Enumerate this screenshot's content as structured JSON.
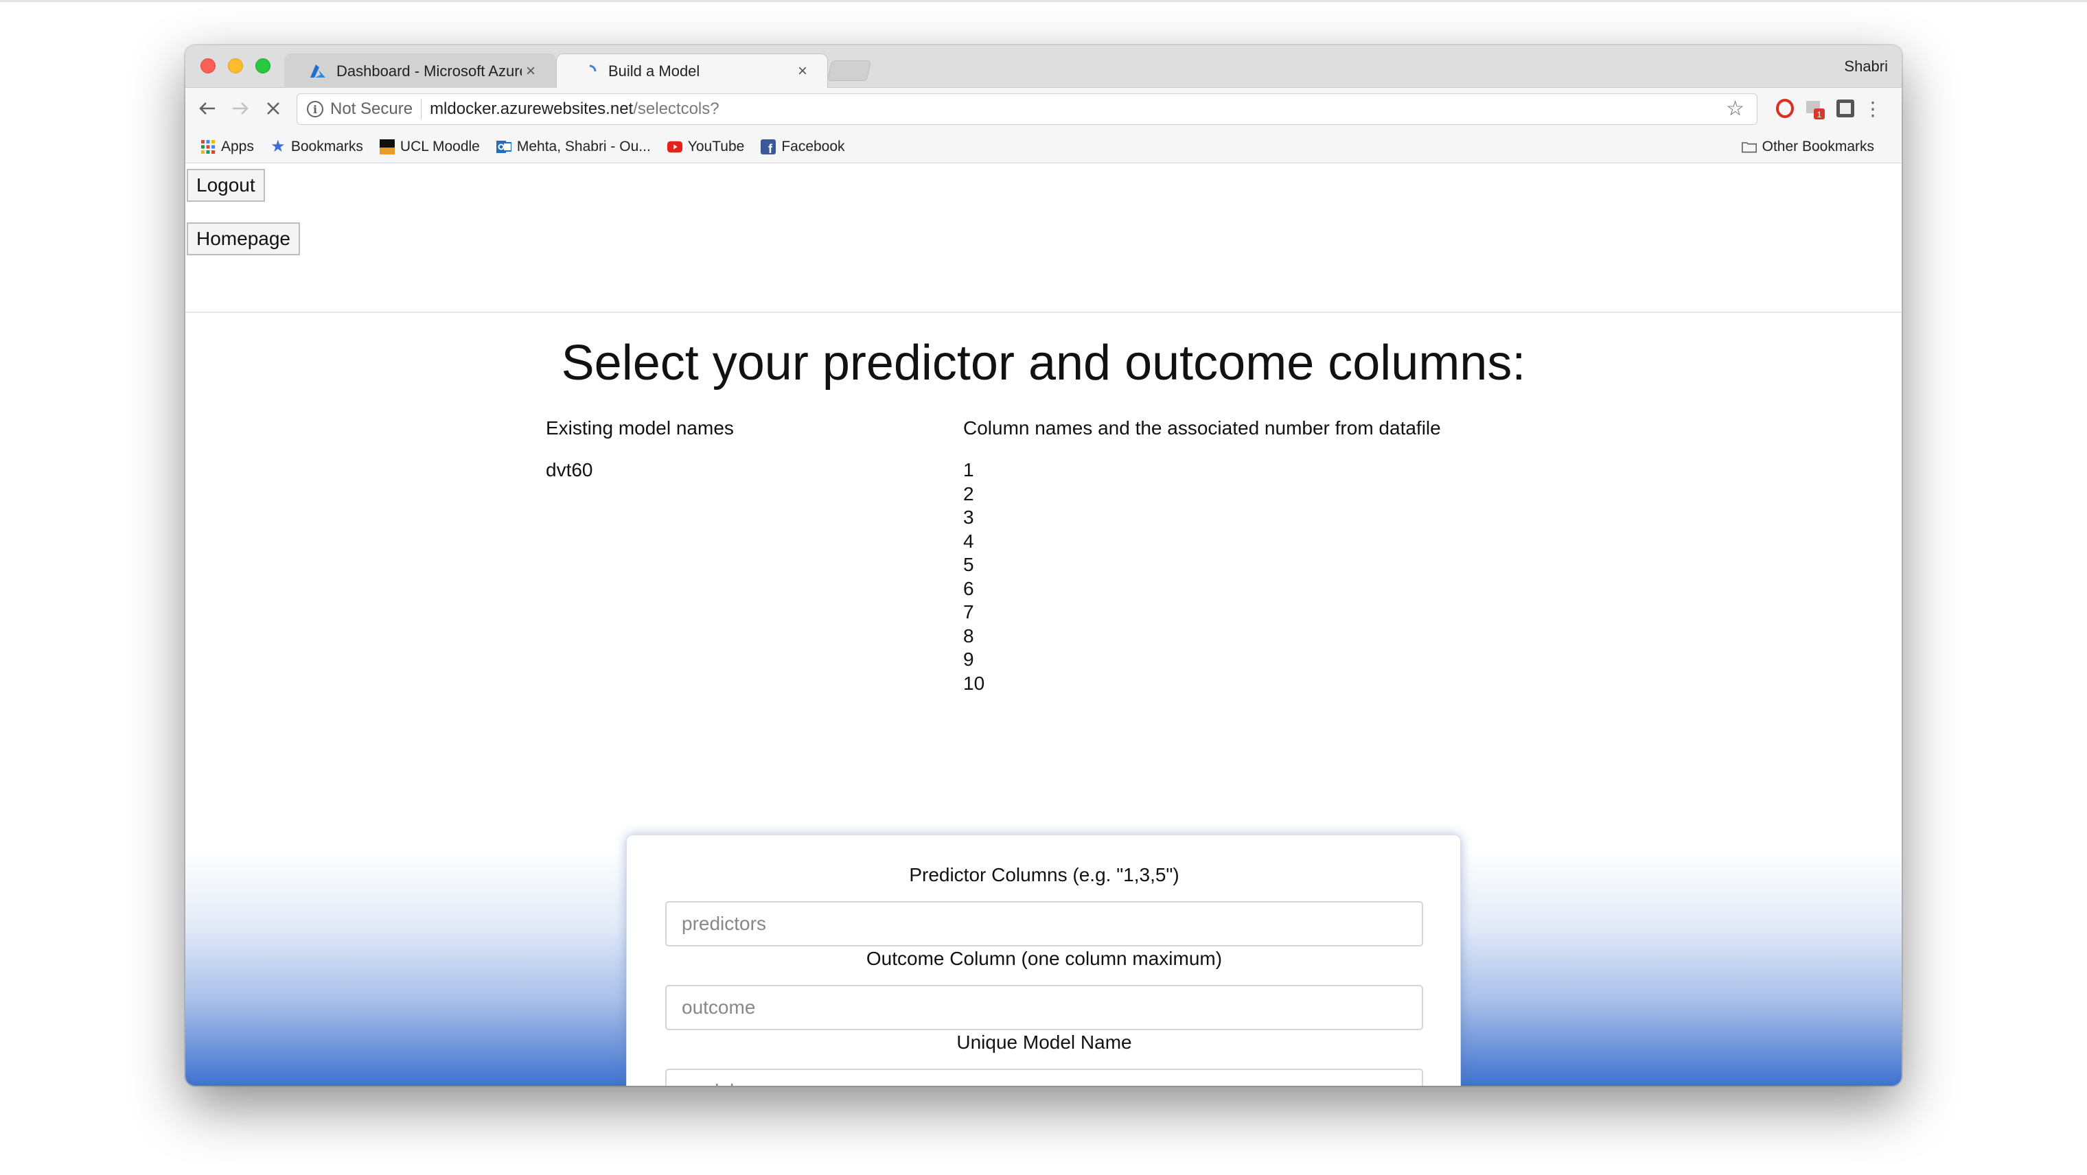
{
  "browser": {
    "tabs": [
      {
        "title": "Dashboard - Microsoft Azure",
        "close": "×",
        "active": false
      },
      {
        "title": "Build a Model",
        "close": "×",
        "active": true
      }
    ],
    "profile_name": "Shabri",
    "security_label": "Not Secure",
    "url_host": "mldocker.azurewebsites.net",
    "url_path": "/selectcols?",
    "extension_badge": "1",
    "bookmarks": [
      {
        "label": "Apps",
        "icon": "apps-grid-icon"
      },
      {
        "label": "Bookmarks",
        "icon": "star-icon"
      },
      {
        "label": "UCL Moodle",
        "icon": "ucl-icon"
      },
      {
        "label": "Mehta, Shabri - Ou...",
        "icon": "outlook-icon"
      },
      {
        "label": "YouTube",
        "icon": "youtube-icon"
      },
      {
        "label": "Facebook",
        "icon": "facebook-icon"
      }
    ],
    "other_bookmarks": "Other Bookmarks"
  },
  "page": {
    "logout_label": "Logout",
    "homepage_label": "Homepage",
    "title": "Select your predictor and outcome columns:",
    "existing_models_header": "Existing model names",
    "existing_models": [
      "dvt60"
    ],
    "columns_header": "Column names and the associated number from datafile",
    "column_numbers": [
      "1",
      "2",
      "3",
      "4",
      "5",
      "6",
      "7",
      "8",
      "9",
      "10"
    ]
  },
  "form": {
    "predictors_label": "Predictor Columns (e.g. \"1,3,5\")",
    "predictors_placeholder": "predictors",
    "outcome_label": "Outcome Column (one column maximum)",
    "outcome_placeholder": "outcome",
    "model_name_label": "Unique Model Name",
    "model_name_placeholder": "model name"
  },
  "colors": {
    "gradient_bottom": "#3f72cf",
    "close_light": "#fc5f57",
    "minimize_light": "#fdbc2e",
    "zoom_light": "#28c840"
  }
}
